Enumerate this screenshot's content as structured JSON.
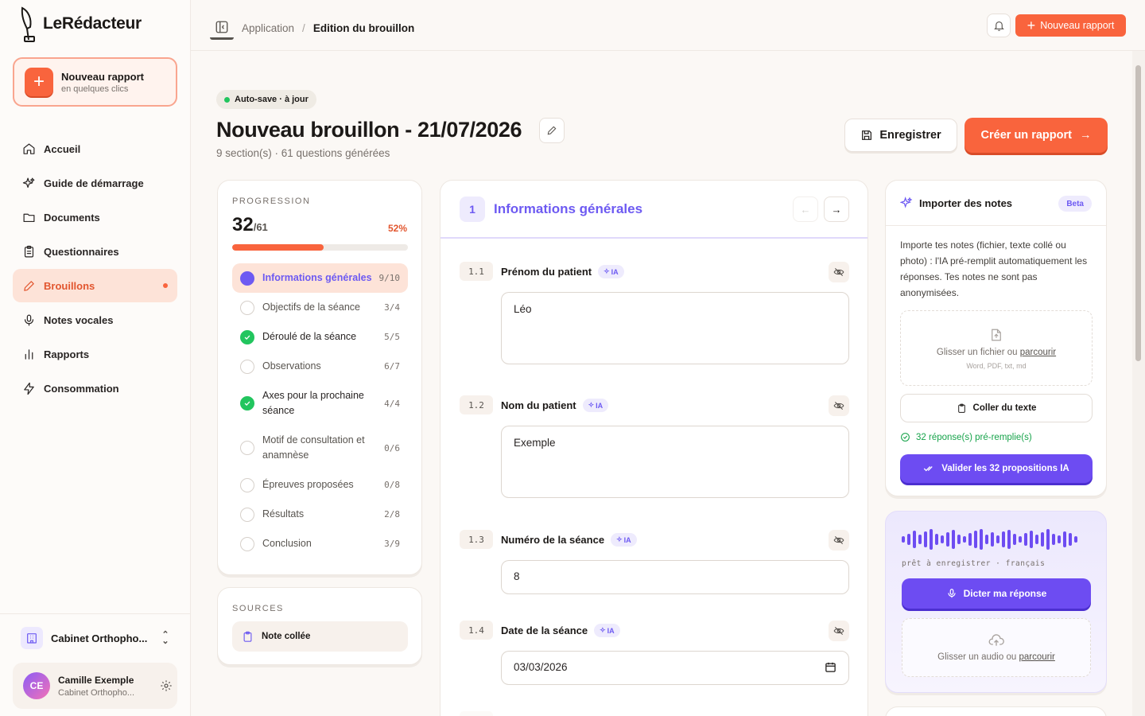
{
  "app": {
    "name": "LeRédacteur"
  },
  "sidebar": {
    "new_card": {
      "title": "Nouveau rapport",
      "subtitle": "en quelques clics"
    },
    "items": [
      {
        "label": "Accueil",
        "icon": "home-icon"
      },
      {
        "label": "Guide de démarrage",
        "icon": "sparkles-icon"
      },
      {
        "label": "Documents",
        "icon": "folder-icon"
      },
      {
        "label": "Questionnaires",
        "icon": "clipboard-icon"
      },
      {
        "label": "Brouillons",
        "icon": "pencil-icon",
        "active": true
      },
      {
        "label": "Notes vocales",
        "icon": "mic-icon"
      },
      {
        "label": "Rapports",
        "icon": "bar-chart-icon"
      },
      {
        "label": "Consommation",
        "icon": "zap-icon"
      }
    ],
    "org": {
      "name": "Cabinet Orthopho..."
    },
    "user": {
      "initials": "CE",
      "name": "Camille Exemple",
      "org": "Cabinet Orthopho..."
    }
  },
  "topbar": {
    "breadcrumb": {
      "parent": "Application",
      "separator": "/",
      "current": "Edition du brouillon"
    },
    "new_report": "Nouveau rapport"
  },
  "draft": {
    "autosave": "Auto-save · à jour",
    "title": "Nouveau brouillon - 21/07/2026",
    "subtitle": "9 section(s) · 61 questions générées",
    "save_label": "Enregistrer",
    "create_label": "Créer un rapport"
  },
  "progress": {
    "label": "PROGRESSION",
    "done": "32",
    "total": "/61",
    "percent_label": "52%",
    "percent": 52,
    "sections": [
      {
        "name": "Informations générales",
        "count": "9/10",
        "state": "current"
      },
      {
        "name": "Objectifs de la séance",
        "count": "3/4",
        "state": "todo"
      },
      {
        "name": "Déroulé de la séance",
        "count": "5/5",
        "state": "done"
      },
      {
        "name": "Observations",
        "count": "6/7",
        "state": "todo"
      },
      {
        "name": "Axes pour la prochaine séance",
        "count": "4/4",
        "state": "done"
      },
      {
        "name": "Motif de consultation et anamnèse",
        "count": "0/6",
        "state": "todo"
      },
      {
        "name": "Épreuves proposées",
        "count": "0/8",
        "state": "todo"
      },
      {
        "name": "Résultats",
        "count": "2/8",
        "state": "todo"
      },
      {
        "name": "Conclusion",
        "count": "3/9",
        "state": "todo"
      }
    ]
  },
  "sources": {
    "label": "SOURCES",
    "note": "Note collée"
  },
  "section": {
    "number": "1",
    "title": "Informations générales",
    "ia_badge": "IA",
    "questions": [
      {
        "num": "1.1",
        "label": "Prénom du patient",
        "value": "Léo"
      },
      {
        "num": "1.2",
        "label": "Nom du patient",
        "value": "Exemple"
      },
      {
        "num": "1.3",
        "label": "Numéro de la séance",
        "value": "8"
      },
      {
        "num": "1.4",
        "label": "Date de la séance",
        "value": "03/03/2026"
      }
    ]
  },
  "import": {
    "title": "Importer des notes",
    "badge": "Beta",
    "description": "Importe tes notes (fichier, texte collé ou photo) : l'IA pré-remplit automatiquement les réponses. Tes notes ne sont pas anonymisées.",
    "drop_text": "Glisser un fichier ou",
    "drop_link": "parcourir",
    "formats": "Word, PDF, txt, md",
    "paste_label": "Coller du texte",
    "prefilled": "32 réponse(s) pré-remplie(s)",
    "validate_label": "Valider les 32 propositions IA"
  },
  "voice": {
    "status": "prêt à enregistrer · français",
    "dictate_label": "Dicter ma réponse",
    "drop_text": "Glisser un audio ou",
    "drop_link": "parcourir"
  },
  "colors": {
    "accent": "#f9643d",
    "violet": "#6d4cf2",
    "success": "#22c55e"
  }
}
